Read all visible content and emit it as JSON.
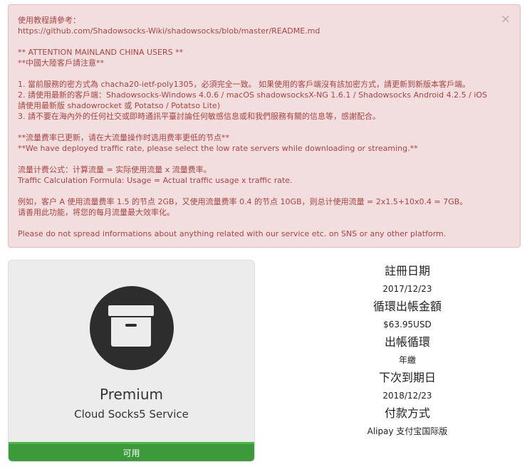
{
  "alert": {
    "close_glyph": "×",
    "lines_1": [
      "使用教程請參考：",
      "https://github.com/Shadowsocks-Wiki/shadowsocks/blob/master/README.md"
    ],
    "lines_2": [
      "** ATTENTION MAINLAND CHINA USERS **",
      "**中國大陸客戶請注意**"
    ],
    "item_1": "1. 當前服務的密方式為 chacha20-ietf-poly1305，必須完全一致。 如果使用的客戶端沒有該加密方式，請更新到新版本客戶端。",
    "item_2": "2. 請使用最新的客戶端：Shadowsocks-Windows 4.0.6 / macOS shadowsocksX-NG 1.6.1 / Shadowsocks Android 4.2.5 / iOS 請使用最新版 shadowrocket 或 Potatso / Potatso Lite)",
    "item_3": "3. 請不要在海內外的任何社交或即時通訊平臺討論任何敏感信息或和我們服務有關的信息等，感謝配合。",
    "lines_3": [
      "**流量费率已更新，请在大流量操作时选用费率更低的节点**",
      "**We have deployed traffic rate, please select the low rate servers while downloading or streaming.**"
    ],
    "lines_4": [
      "流量计费公式：计算流量 = 实际使用流量 x 流量费率。",
      "Traffic Calculation Formula: Usage = Actual traffic usage x traffic rate."
    ],
    "lines_5": [
      "例如，客户 A 使用流量费率 1.5 的节点 2GB，又使用流量费率 0.4 的节点 10GB，则总计使用流量 = 2x1.5+10x0.4 = 7GB。",
      "请善用此功能，将您的每月流量最大效率化。"
    ],
    "footer": "Please do not spread informations about anything related with our service etc. on SNS or any other platform."
  },
  "product": {
    "icon": "archive-box-icon",
    "name": "Premium",
    "subtitle": "Cloud Socks5 Service",
    "status": "可用",
    "status_color": "#3d9a3a"
  },
  "details": {
    "reg_label": "註冊日期",
    "reg_value": "2017/12/23",
    "amount_label": "循環出帳金額",
    "amount_value": "$63.95USD",
    "cycle_label": "出帳循環",
    "cycle_value": "年繳",
    "due_label": "下次到期日",
    "due_value": "2018/12/23",
    "pay_label": "付款方式",
    "pay_value": "Alipay 支付宝国际版"
  }
}
